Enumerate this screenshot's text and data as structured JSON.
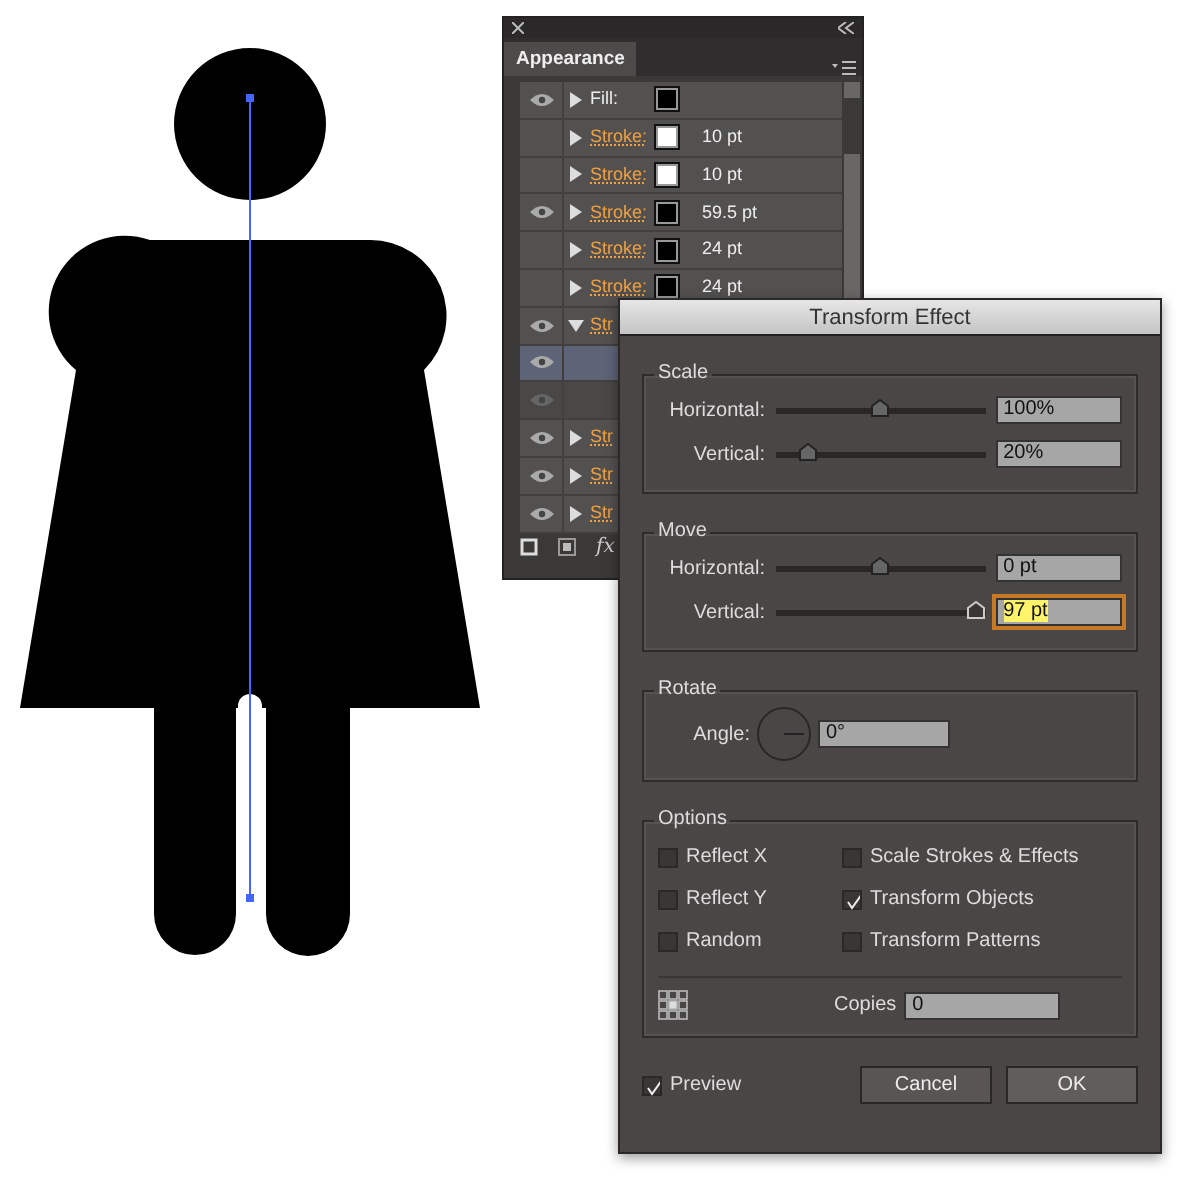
{
  "appearance_panel": {
    "tab": "Appearance",
    "rows": [
      {
        "kind": "fill",
        "label": "Fill:",
        "color": "#000000",
        "visible": true,
        "dimmed": false,
        "expanded": false,
        "selected": false
      },
      {
        "kind": "stroke",
        "label": "Stroke:",
        "color": "#ffffff",
        "value": "10 pt",
        "visible": false,
        "dimmed": false,
        "expanded": false,
        "selected": false
      },
      {
        "kind": "stroke",
        "label": "Stroke:",
        "color": "#ffffff",
        "value": "10 pt",
        "visible": false,
        "dimmed": false,
        "expanded": false,
        "selected": false
      },
      {
        "kind": "stroke",
        "label": "Stroke:",
        "color": "#000000",
        "value": "59.5 pt",
        "visible": true,
        "dimmed": false,
        "expanded": false,
        "selected": false
      },
      {
        "kind": "stroke",
        "label": "Stroke:",
        "color": "#000000",
        "value": "24 pt",
        "visible": false,
        "dimmed": false,
        "expanded": false,
        "selected": false
      },
      {
        "kind": "stroke",
        "label": "Stroke:",
        "color": "#000000",
        "value": "24 pt",
        "visible": false,
        "dimmed": false,
        "expanded": false,
        "selected": false
      },
      {
        "kind": "stroke",
        "label": "Str",
        "visible": true,
        "dimmed": false,
        "expanded": true,
        "selected": false
      },
      {
        "kind": "blank",
        "visible": true,
        "dimmed": false,
        "selected": true
      },
      {
        "kind": "blank",
        "visible": true,
        "dimmed": true,
        "selected": false
      },
      {
        "kind": "stroke",
        "label": "Str",
        "visible": true,
        "dimmed": false,
        "expanded": false,
        "selected": false
      },
      {
        "kind": "stroke",
        "label": "Str",
        "visible": true,
        "dimmed": false,
        "expanded": false,
        "selected": false
      },
      {
        "kind": "stroke",
        "label": "Str",
        "visible": true,
        "dimmed": false,
        "expanded": false,
        "selected": false
      }
    ],
    "fx": "fx"
  },
  "dialog": {
    "title": "Transform Effect",
    "scale": {
      "title": "Scale",
      "rows": [
        {
          "label": "Horizontal:",
          "level": 0.5,
          "value": "100%",
          "focused": false
        },
        {
          "label": "Vertical:",
          "level": 0.12,
          "value": "20%",
          "focused": false
        }
      ]
    },
    "move": {
      "title": "Move",
      "rows": [
        {
          "label": "Horizontal:",
          "level": 0.5,
          "value": "0 pt",
          "focused": false
        },
        {
          "label": "Vertical:",
          "level": 1.0,
          "value": "97 pt",
          "focused": true
        }
      ]
    },
    "rotate": {
      "title": "Rotate",
      "label": "Angle:",
      "value": "0°"
    },
    "options": {
      "title": "Options",
      "checkboxes": [
        {
          "label": "Reflect X",
          "checked": false
        },
        {
          "label": "Scale Strokes & Effects",
          "checked": false
        },
        {
          "label": "Reflect Y",
          "checked": false
        },
        {
          "label": "Transform Objects",
          "checked": true
        },
        {
          "label": "Random",
          "checked": false
        },
        {
          "label": "Transform Patterns",
          "checked": false
        }
      ],
      "copies_label": "Copies",
      "copies_value": "0"
    },
    "preview": {
      "label": "Preview",
      "checked": true
    },
    "buttons": [
      "Cancel",
      "OK"
    ]
  }
}
